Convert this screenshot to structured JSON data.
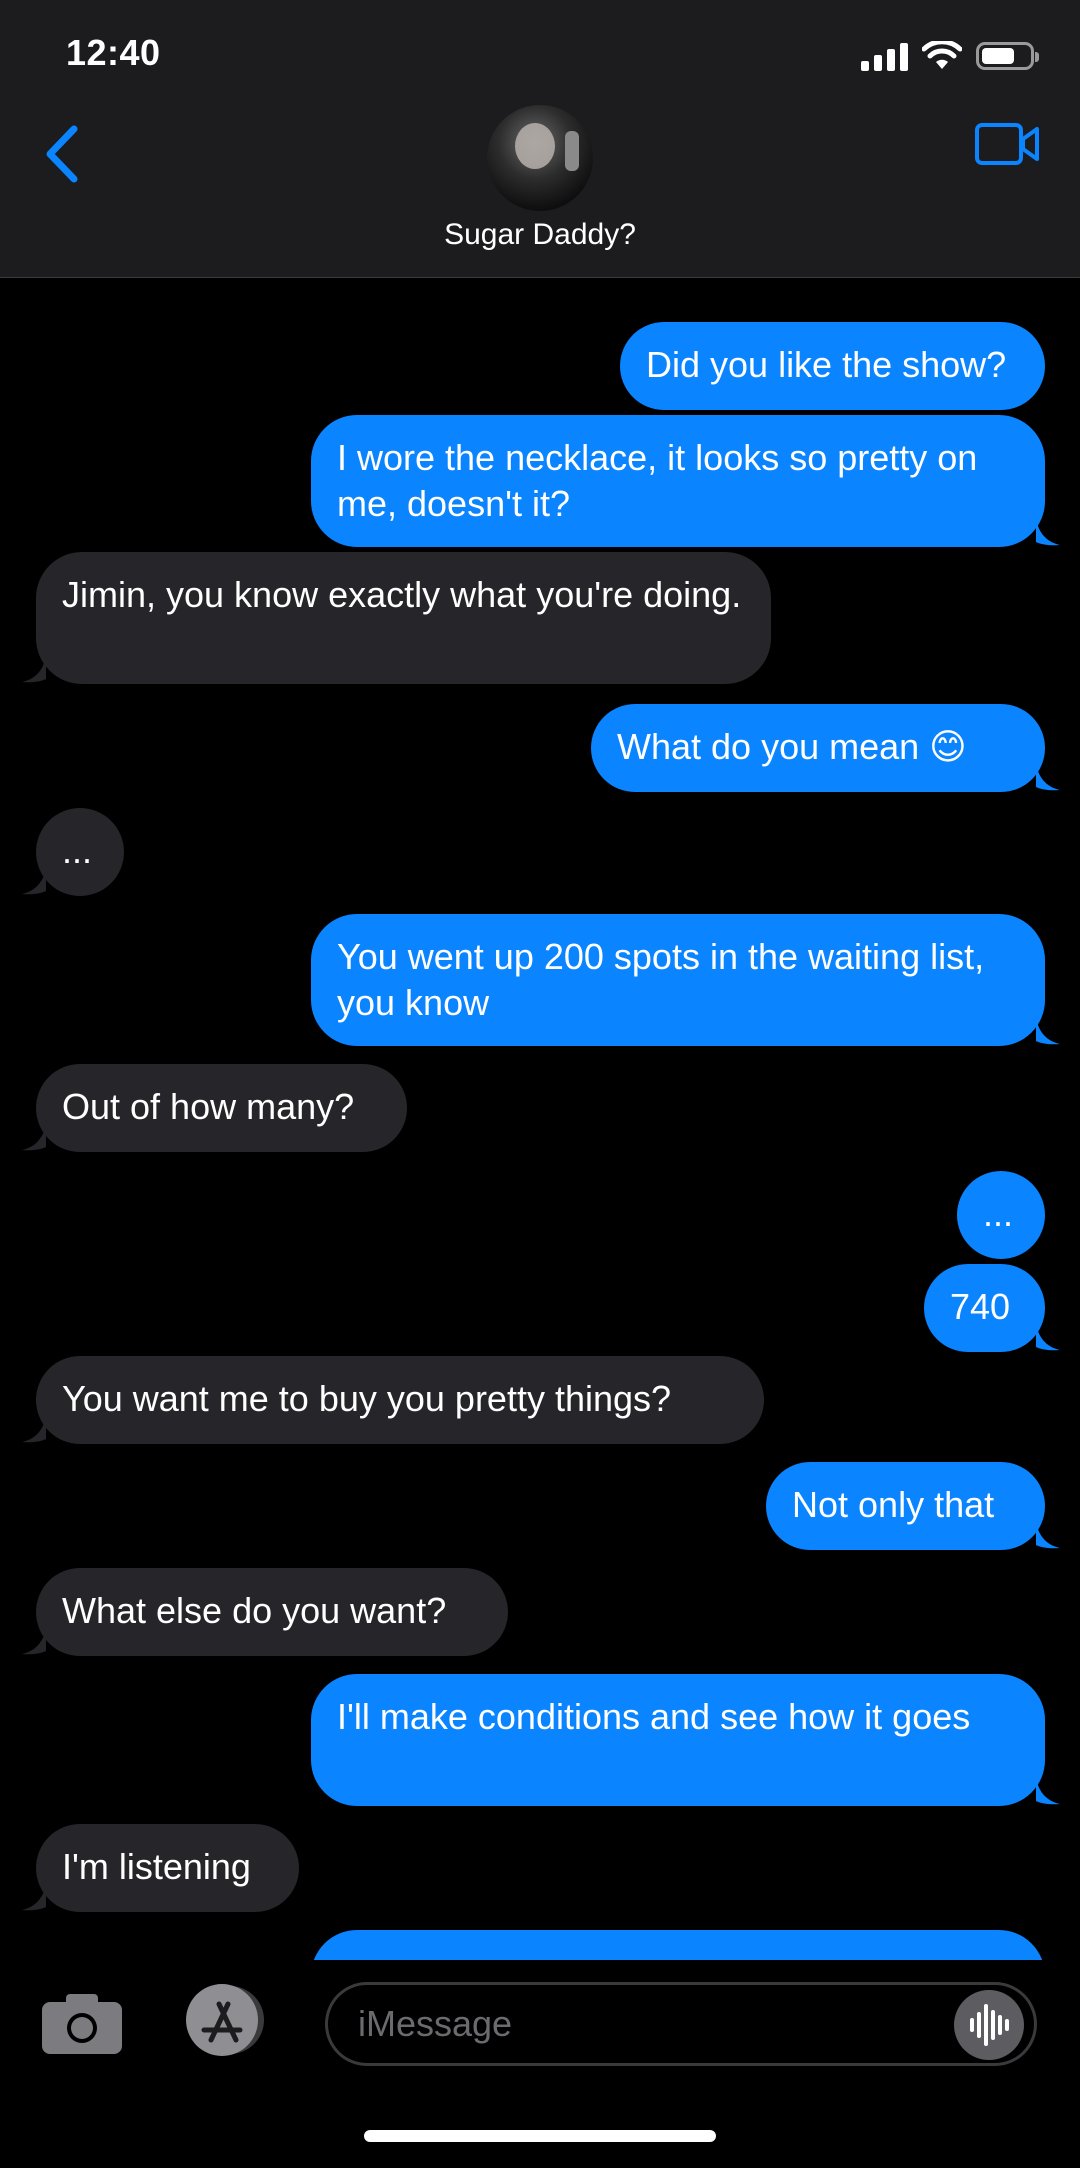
{
  "status_bar": {
    "time": "12:40",
    "icons": [
      "signal-icon",
      "wifi-icon",
      "battery-icon"
    ],
    "battery_level": 0.7
  },
  "header": {
    "back_icon": "chevron-left-icon",
    "contact_name": "Sugar Daddy?",
    "video_icon": "video-camera-icon",
    "accent_color": "#0a84ff"
  },
  "messages": [
    {
      "direction": "out",
      "text": "Did you like the show?"
    },
    {
      "direction": "out",
      "text": "I wore the necklace, it looks so pretty on me, doesn't it?"
    },
    {
      "direction": "in",
      "text": "Jimin, you know exactly what you're doing."
    },
    {
      "direction": "out",
      "text": "What do you mean 😊"
    },
    {
      "direction": "in",
      "text": "..."
    },
    {
      "direction": "out",
      "text": "You went up 200 spots in the waiting list, you know"
    },
    {
      "direction": "in",
      "text": "Out of how many?"
    },
    {
      "direction": "out",
      "text": "..."
    },
    {
      "direction": "out",
      "text": "740"
    },
    {
      "direction": "in",
      "text": "You want me to buy you pretty things?"
    },
    {
      "direction": "out",
      "text": "Not only that"
    },
    {
      "direction": "in",
      "text": "What else do you want?"
    },
    {
      "direction": "out",
      "text": "I'll make conditions and see how it goes"
    },
    {
      "direction": "in",
      "text": "I'm listening"
    }
  ],
  "colors": {
    "outgoing_bubble": "#0a84ff",
    "incoming_bubble": "#26252a",
    "background": "#000000",
    "header_background": "#1c1c1e"
  },
  "input_bar": {
    "camera_icon": "camera-icon",
    "apps_icon": "app-store-icon",
    "placeholder": "iMessage",
    "voice_icon": "waveform-icon"
  }
}
